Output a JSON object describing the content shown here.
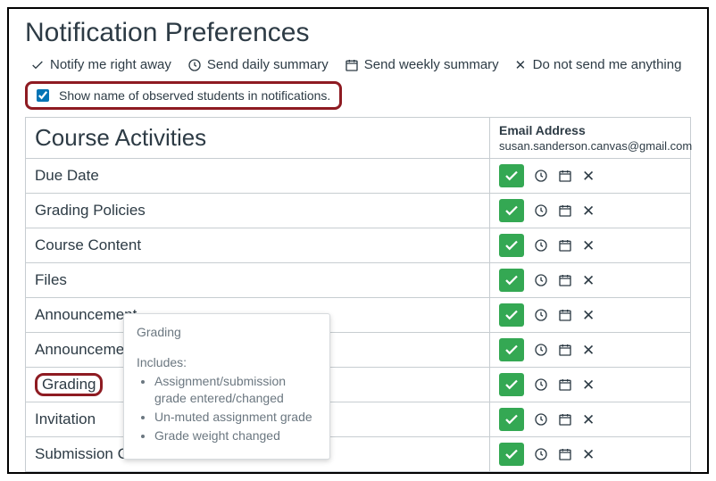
{
  "page": {
    "title": "Notification Preferences"
  },
  "legend": {
    "immediately": "Notify me right away",
    "daily": "Send daily summary",
    "weekly": "Send weekly summary",
    "never": "Do not send me anything"
  },
  "observed": {
    "label": "Show name of observed students in notifications."
  },
  "table": {
    "activities_header": "Course Activities",
    "channel_title": "Email Address",
    "channel_sub": "susan.sanderson.canvas@gmail.com",
    "rows": [
      "Due Date",
      "Grading Policies",
      "Course Content",
      "Files",
      "Announcement",
      "Announcement Created By You",
      "Grading",
      "Invitation",
      "Submission Comment"
    ]
  },
  "highlight_row_index": 6,
  "tooltip": {
    "title": "Grading",
    "includes_label": "Includes:",
    "items": [
      "Assignment/submission grade entered/changed",
      "Un-muted assignment grade",
      "Grade weight changed"
    ]
  }
}
